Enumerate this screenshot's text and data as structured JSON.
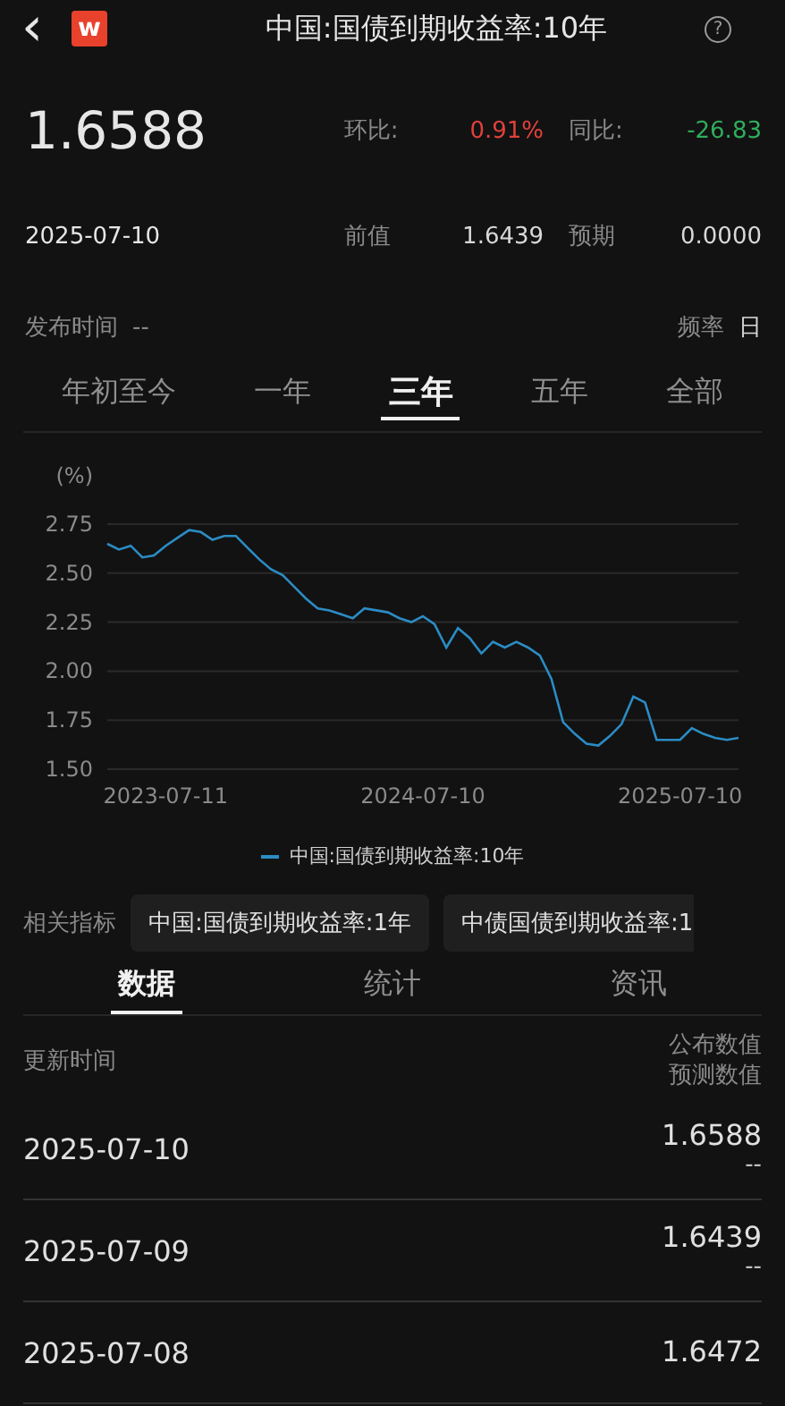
{
  "header": {
    "back": "‹",
    "logo": "w",
    "title": "中国:国债到期收益率:10年",
    "help": "?"
  },
  "summary": {
    "value": "1.6588",
    "date": "2025-07-10",
    "stats": [
      {
        "label": "环比:",
        "value": "0.91%",
        "color": "#e0413c"
      },
      {
        "label": "同比:",
        "value": "-26.83",
        "color": "#2fae5c"
      }
    ],
    "prev": {
      "label": "前值",
      "value": "1.6439"
    },
    "expected": {
      "label": "预期",
      "value": "0.0000"
    },
    "release": {
      "label": "发布时间",
      "value": "--"
    },
    "frequency": {
      "label": "频率",
      "value": "日"
    }
  },
  "range_tabs": [
    {
      "label": "年初至今",
      "selected": false
    },
    {
      "label": "一年",
      "selected": false
    },
    {
      "label": "三年",
      "selected": true
    },
    {
      "label": "五年",
      "selected": false
    },
    {
      "label": "全部",
      "selected": false
    }
  ],
  "chart": {
    "chart_data": {
      "type": "line",
      "ylabel": "(%)",
      "grid": true,
      "categories": [
        null,
        null,
        null,
        null,
        null,
        "2023-07-11",
        null,
        null,
        null,
        null,
        null,
        null,
        null,
        null,
        null,
        null,
        null,
        null,
        null,
        null,
        null,
        null,
        null,
        null,
        null,
        null,
        null,
        "2024-07-10",
        null,
        null,
        null,
        null,
        null,
        null,
        null,
        null,
        null,
        null,
        null,
        null,
        null,
        null,
        null,
        null,
        null,
        null,
        null,
        null,
        null,
        "2025-07-10",
        null,
        null,
        null,
        null,
        null
      ],
      "series": [
        {
          "name": "中国:国债到期收益率:10年",
          "color": "#2b8cc4",
          "values": [
            2.65,
            2.62,
            2.64,
            2.58,
            2.59,
            2.64,
            2.68,
            2.72,
            2.71,
            2.67,
            2.69,
            2.69,
            2.63,
            2.57,
            2.52,
            2.49,
            2.43,
            2.37,
            2.32,
            2.31,
            2.29,
            2.27,
            2.32,
            2.31,
            2.3,
            2.27,
            2.25,
            2.28,
            2.24,
            2.12,
            2.22,
            2.17,
            2.09,
            2.15,
            2.12,
            2.15,
            2.12,
            2.08,
            1.96,
            1.74,
            1.68,
            1.63,
            1.62,
            1.67,
            1.73,
            1.87,
            1.84,
            1.65,
            1.65,
            1.65,
            1.71,
            1.68,
            1.66,
            1.65,
            1.66
          ]
        }
      ],
      "ylim": [
        1.5,
        2.75
      ],
      "yticks": [
        {
          "value": 1.5,
          "label": "1.50"
        },
        {
          "value": 1.75,
          "label": "1.75"
        },
        {
          "value": 2,
          "label": "2.00"
        },
        {
          "value": 2.25,
          "label": "2.25"
        },
        {
          "value": 2.5,
          "label": "2.50"
        },
        {
          "value": 2.75,
          "label": "2.75"
        }
      ]
    }
  },
  "related": {
    "label": "相关指标",
    "items": [
      "中国:国债到期收益率:1年",
      "中债国债到期收益率:1"
    ]
  },
  "data_tabs": [
    {
      "label": "数据",
      "selected": true
    },
    {
      "label": "统计",
      "selected": false
    },
    {
      "label": "资讯",
      "selected": false
    }
  ],
  "table": {
    "date_header": "更新时间",
    "value_headers": [
      "公布数值",
      "预测数值"
    ],
    "rows": [
      {
        "date": "2025-07-10",
        "actual": "1.6588",
        "forecast": "--"
      },
      {
        "date": "2025-07-09",
        "actual": "1.6439",
        "forecast": "--"
      },
      {
        "date": "2025-07-08",
        "actual": "1.6472"
      }
    ]
  }
}
